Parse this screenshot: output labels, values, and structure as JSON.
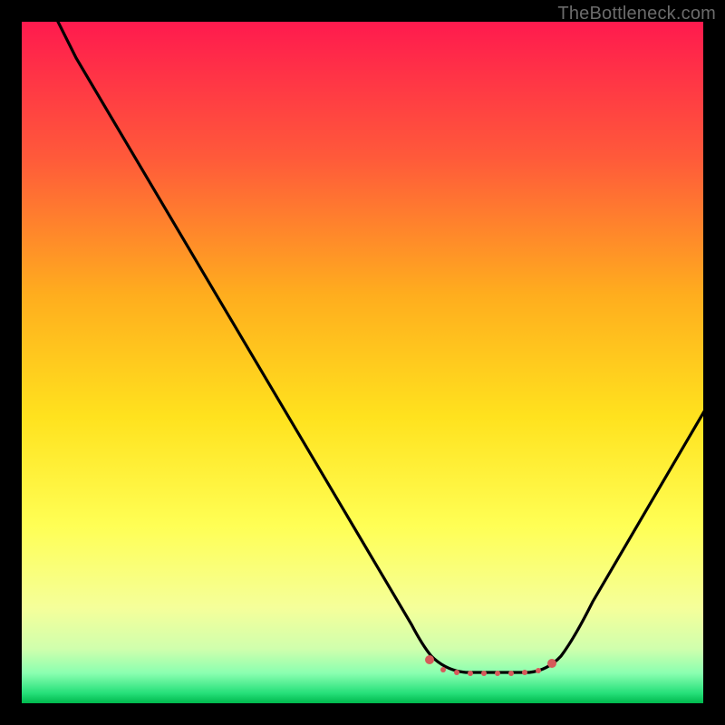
{
  "watermark": "TheBottleneck.com",
  "colors": {
    "top": "#ff1a4e",
    "mid1": "#ff7a2a",
    "mid2": "#ffd21e",
    "mid3": "#ffff4d",
    "low1": "#f2ffad",
    "low2": "#9eff9e",
    "bottom": "#00c853",
    "curve": "#000000",
    "marker": "#d65a5a",
    "frame": "#000000"
  },
  "chart_data": {
    "type": "line",
    "title": "",
    "xlabel": "",
    "ylabel": "",
    "xlim": [
      0,
      100
    ],
    "ylim": [
      0,
      100
    ],
    "x": [
      5,
      10,
      15,
      20,
      25,
      30,
      35,
      40,
      45,
      50,
      55,
      58,
      60,
      63,
      66,
      70,
      73,
      76,
      80,
      85,
      90,
      95,
      100
    ],
    "values": [
      100,
      92,
      83,
      75,
      66,
      58,
      49,
      41,
      32,
      24,
      15,
      10,
      7,
      4,
      2,
      0,
      0,
      1,
      4,
      12,
      22,
      32,
      43
    ],
    "flat_region": {
      "x_start": 60,
      "x_end": 78,
      "y": 4
    },
    "markers": [
      {
        "x": 60,
        "y": 7
      },
      {
        "x": 78,
        "y": 7
      }
    ],
    "annotations": []
  }
}
